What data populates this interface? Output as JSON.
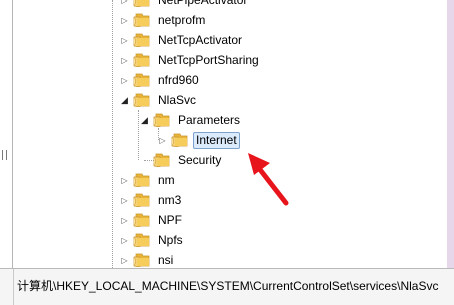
{
  "tree": {
    "items": [
      {
        "label": "NetPipeActivator",
        "expanded": false,
        "selected": false
      },
      {
        "label": "netprofm",
        "expanded": false,
        "selected": false
      },
      {
        "label": "NetTcpActivator",
        "expanded": false,
        "selected": false
      },
      {
        "label": "NetTcpPortSharing",
        "expanded": false,
        "selected": false
      },
      {
        "label": "nfrd960",
        "expanded": false,
        "selected": false
      },
      {
        "label": "NlaSvc",
        "expanded": true,
        "selected": false
      },
      {
        "label": "Parameters",
        "expanded": true,
        "selected": false
      },
      {
        "label": "Internet",
        "expanded": false,
        "selected": true
      },
      {
        "label": "Security",
        "expanded": false,
        "selected": false
      },
      {
        "label": "nm",
        "expanded": false,
        "selected": false
      },
      {
        "label": "nm3",
        "expanded": false,
        "selected": false
      },
      {
        "label": "NPF",
        "expanded": false,
        "selected": false
      },
      {
        "label": "Npfs",
        "expanded": false,
        "selected": false
      },
      {
        "label": "nsi",
        "expanded": false,
        "selected": false
      }
    ]
  },
  "status_bar": {
    "path": "计算机\\HKEY_LOCAL_MACHINE\\SYSTEM\\CurrentControlSet\\services\\NlaSvc"
  },
  "annotation": {
    "icon": "red-arrow-icon",
    "color": "#e8141b"
  },
  "colors": {
    "folder": "#f0c24b",
    "selection": "#dcebfc",
    "background": "#e7d7ea"
  }
}
